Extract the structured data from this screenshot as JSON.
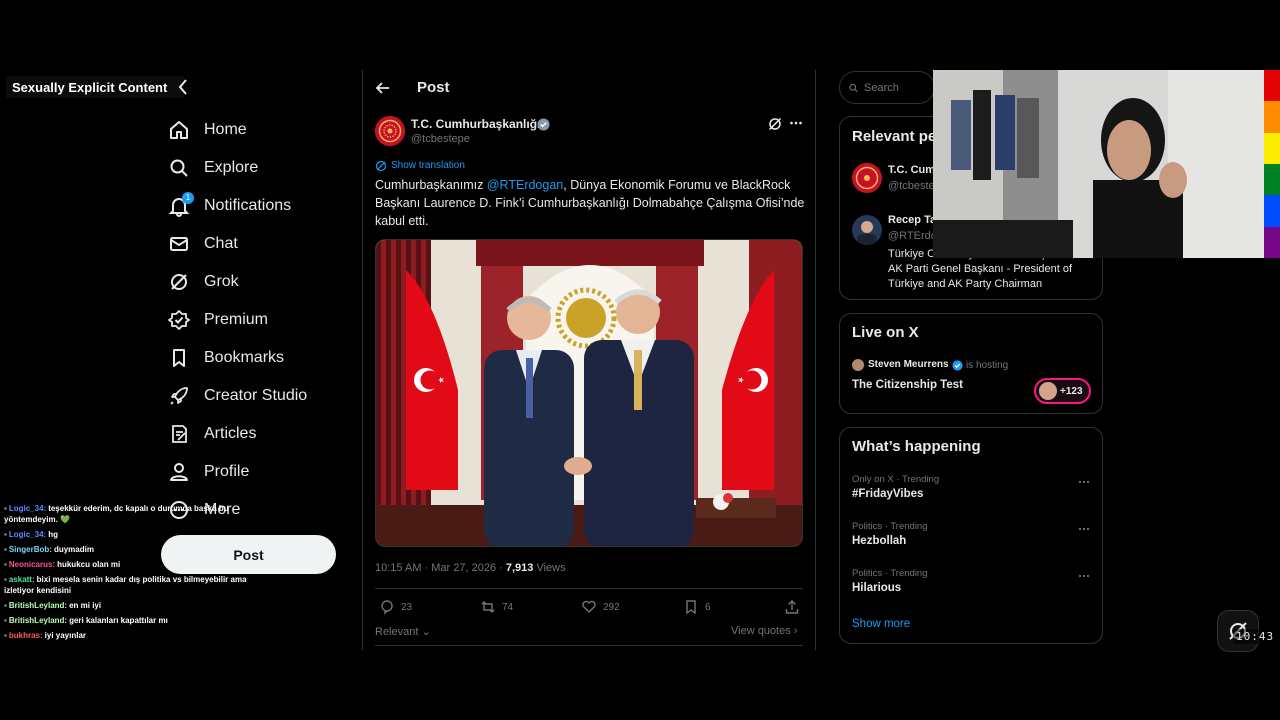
{
  "overlay": {
    "explicit_label": "Sexually Explicit Content"
  },
  "nav": {
    "items": [
      {
        "label": "Home",
        "icon": "home-icon"
      },
      {
        "label": "Explore",
        "icon": "search-icon"
      },
      {
        "label": "Notifications",
        "icon": "bell-icon",
        "badge": "1"
      },
      {
        "label": "Chat",
        "icon": "mail-icon"
      },
      {
        "label": "Grok",
        "icon": "grok-icon"
      },
      {
        "label": "Premium",
        "icon": "premium-icon"
      },
      {
        "label": "Bookmarks",
        "icon": "bookmark-icon"
      },
      {
        "label": "Creator Studio",
        "icon": "rocket-icon"
      },
      {
        "label": "Articles",
        "icon": "articles-icon"
      },
      {
        "label": "Profile",
        "icon": "person-icon"
      },
      {
        "label": "More",
        "icon": "more-circle-icon"
      }
    ],
    "post_button": "Post"
  },
  "chat": [
    {
      "user": "Logic_34:",
      "color": "#5b8cff",
      "msg": "teşekkür ederim, dc kapalı o durumda başka bu yöntemdeyim. 💚"
    },
    {
      "user": "Logic_34:",
      "color": "#5b8cff",
      "msg": "hg"
    },
    {
      "user": "SingerBob:",
      "color": "#7fd4ff",
      "msg": "duymadim"
    },
    {
      "user": "Neonicarus:",
      "color": "#ff4f9a",
      "msg": "hukukcu olan mi"
    },
    {
      "user": "askatt:",
      "color": "#4fe3a0",
      "msg": "bixi mesela senin kadar dış politika vs bilmeyebilir ama izletiyor kendisini"
    },
    {
      "user": "BritishLeyland:",
      "color": "#b6ffb0",
      "msg": "en mi iyi"
    },
    {
      "user": "BritishLeyland:",
      "color": "#b6ffb0",
      "msg": "geri kalanları kapattılar mı"
    },
    {
      "user": "bukhras:",
      "color": "#ff5a5a",
      "msg": "iyi yayınlar"
    }
  ],
  "post": {
    "heading": "Post",
    "author_name": "T.C. Cumhurbaşkanlığı",
    "author_handle": "@tcbestepe",
    "show_translation": "Show translation",
    "text_before": "Cumhurbaşkanımız ",
    "mention": "@RTErdogan",
    "text_after": ", Dünya Ekonomik Forumu ve BlackRock Başkanı Laurence D. Fink’i Cumhurbaşkanlığı Dolmabahçe Çalışma Ofisi’nde kabul etti.",
    "timestamp": "10:15 AM · Mar 27, 2026 · ",
    "views_count": "7,913",
    "views_label": " Views",
    "replies": "23",
    "reposts": "74",
    "likes": "292",
    "bookmarks": "6",
    "sort_label": "Relevant",
    "view_quotes": "View quotes"
  },
  "sidebar_right": {
    "search_placeholder": "Search",
    "relevant_title": "Relevant people",
    "people": [
      {
        "name": "T.C. Cumhurbaşkanlığı",
        "handle": "@tcbestepe"
      },
      {
        "name": "Recep Tayyip Erdoğan",
        "handle": "@RTErdogan",
        "bio": "Türkiye Cumhuriyeti Cumhurbaşkanı - AK Parti Genel Başkanı - President of Türkiye and AK Party Chairman"
      }
    ],
    "live_title": "Live on X",
    "live_host": "Steven Meurrens",
    "live_hosting": "is hosting",
    "live_space": "The Citizenship Test",
    "live_count": "+123",
    "happening_title": "What’s happening",
    "trends": [
      {
        "meta": "Only on X · Trending",
        "name": "#FridayVibes"
      },
      {
        "meta": "Politics · Trending",
        "name": "Hezbollah"
      },
      {
        "meta": "Politics · Trending",
        "name": "Hilarious"
      }
    ],
    "show_more": "Show more"
  },
  "stream": {
    "clock": "10:43"
  },
  "colors": {
    "accent": "#1d9bf0",
    "flag_red": "#e30a17",
    "rainbow": [
      "#e40303",
      "#ff8c00",
      "#ffed00",
      "#008026",
      "#004dff",
      "#750787"
    ]
  }
}
